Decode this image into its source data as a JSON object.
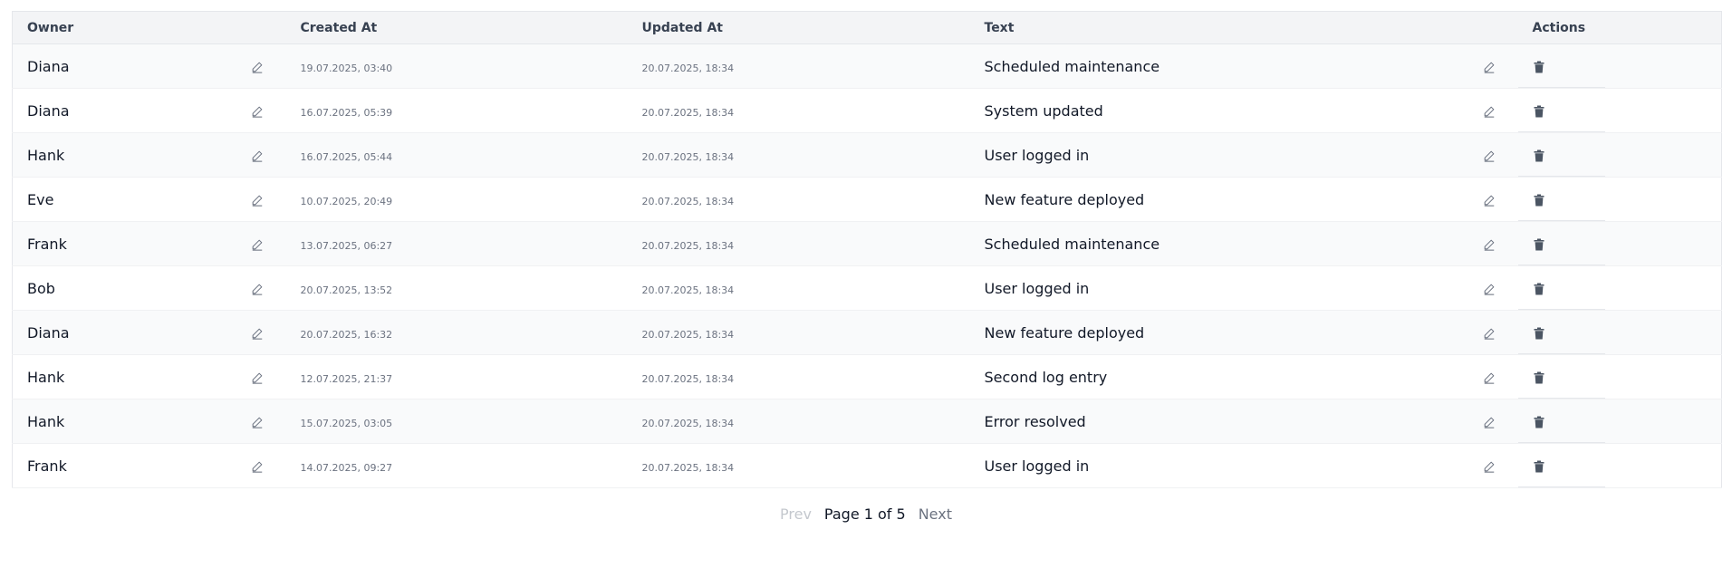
{
  "table": {
    "columns": {
      "owner": "Owner",
      "created_at": "Created At",
      "updated_at": "Updated At",
      "text": "Text",
      "actions": "Actions"
    },
    "rows": [
      {
        "owner": "Diana",
        "created_at": "19.07.2025, 03:40",
        "updated_at": "20.07.2025, 18:34",
        "text": "Scheduled maintenance"
      },
      {
        "owner": "Diana",
        "created_at": "16.07.2025, 05:39",
        "updated_at": "20.07.2025, 18:34",
        "text": "System updated"
      },
      {
        "owner": "Hank",
        "created_at": "16.07.2025, 05:44",
        "updated_at": "20.07.2025, 18:34",
        "text": "User logged in"
      },
      {
        "owner": "Eve",
        "created_at": "10.07.2025, 20:49",
        "updated_at": "20.07.2025, 18:34",
        "text": "New feature deployed"
      },
      {
        "owner": "Frank",
        "created_at": "13.07.2025, 06:27",
        "updated_at": "20.07.2025, 18:34",
        "text": "Scheduled maintenance"
      },
      {
        "owner": "Bob",
        "created_at": "20.07.2025, 13:52",
        "updated_at": "20.07.2025, 18:34",
        "text": "User logged in"
      },
      {
        "owner": "Diana",
        "created_at": "20.07.2025, 16:32",
        "updated_at": "20.07.2025, 18:34",
        "text": "New feature deployed"
      },
      {
        "owner": "Hank",
        "created_at": "12.07.2025, 21:37",
        "updated_at": "20.07.2025, 18:34",
        "text": "Second log entry"
      },
      {
        "owner": "Hank",
        "created_at": "15.07.2025, 03:05",
        "updated_at": "20.07.2025, 18:34",
        "text": "Error resolved"
      },
      {
        "owner": "Frank",
        "created_at": "14.07.2025, 09:27",
        "updated_at": "20.07.2025, 18:34",
        "text": "User logged in"
      }
    ]
  },
  "pagination": {
    "prev_label": "Prev",
    "page_info": "Page 1 of 5",
    "next_label": "Next"
  },
  "icons": {
    "edit": "pencil-icon",
    "delete": "trash-icon"
  },
  "colors": {
    "header_bg": "#f3f4f6",
    "row_alt_bg": "#f9fafb",
    "icon_color": "#4b5563"
  }
}
